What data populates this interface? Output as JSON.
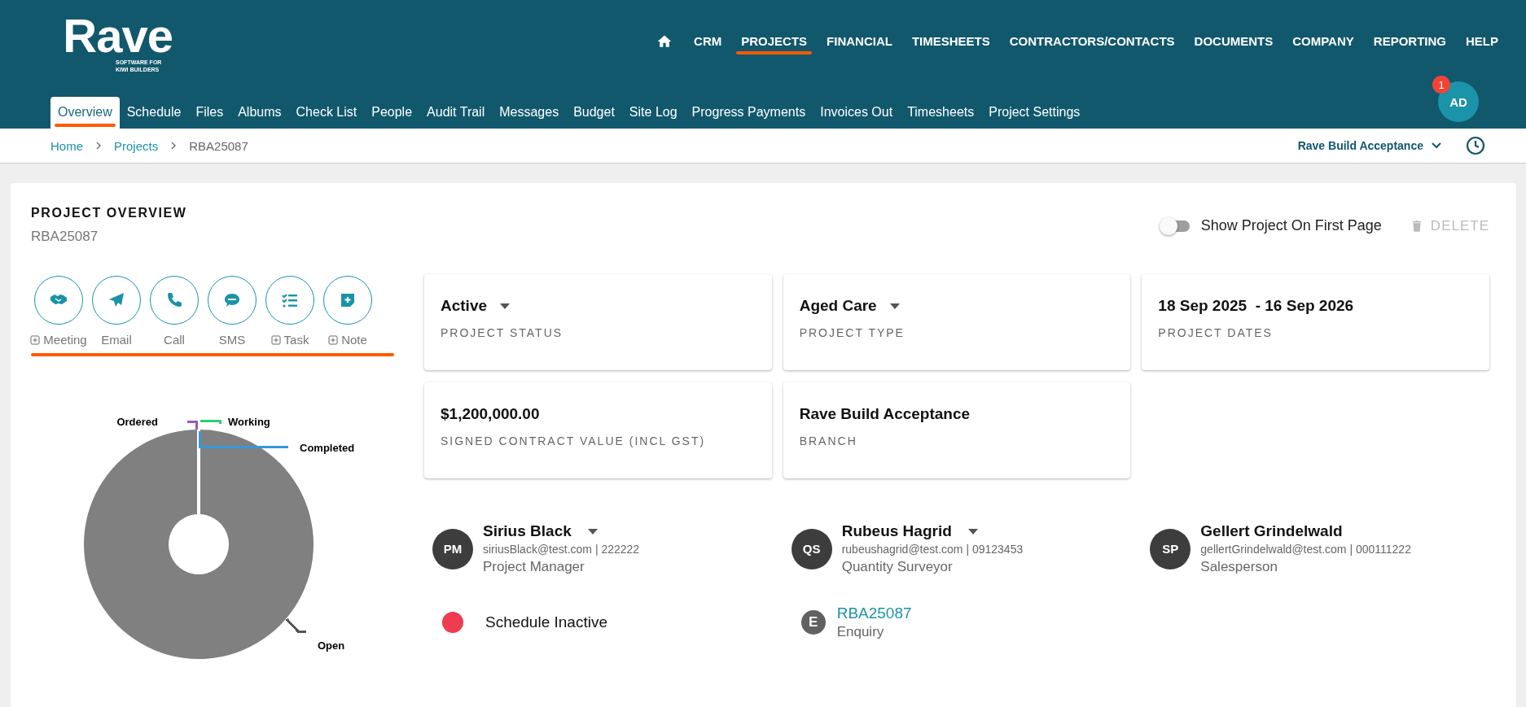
{
  "logo": {
    "name": "Rave",
    "tagline": "SOFTWARE FOR KIWI BUILDERS"
  },
  "top_nav": [
    {
      "label": "CRM",
      "selected": false
    },
    {
      "label": "PROJECTS",
      "selected": true
    },
    {
      "label": "FINANCIAL",
      "selected": false
    },
    {
      "label": "TIMESHEETS",
      "selected": false
    },
    {
      "label": "CONTRACTORS/CONTACTS",
      "selected": false
    },
    {
      "label": "DOCUMENTS",
      "selected": false
    },
    {
      "label": "COMPANY",
      "selected": false
    },
    {
      "label": "REPORTING",
      "selected": false
    },
    {
      "label": "HELP",
      "selected": false
    }
  ],
  "user": {
    "initials": "AD",
    "notifications": "1"
  },
  "tabs": [
    {
      "label": "Overview",
      "selected": true
    },
    {
      "label": "Schedule",
      "selected": false
    },
    {
      "label": "Files",
      "selected": false
    },
    {
      "label": "Albums",
      "selected": false
    },
    {
      "label": "Check List",
      "selected": false
    },
    {
      "label": "People",
      "selected": false
    },
    {
      "label": "Audit Trail",
      "selected": false
    },
    {
      "label": "Messages",
      "selected": false
    },
    {
      "label": "Budget",
      "selected": false
    },
    {
      "label": "Site Log",
      "selected": false
    },
    {
      "label": "Progress Payments",
      "selected": false
    },
    {
      "label": "Invoices Out",
      "selected": false
    },
    {
      "label": "Timesheets",
      "selected": false
    },
    {
      "label": "Project Settings",
      "selected": false
    }
  ],
  "breadcrumb": [
    "Home",
    "Projects",
    "RBA25087"
  ],
  "branch_selector": "Rave Build Acceptance",
  "overview": {
    "title": "PROJECT OVERVIEW",
    "code": "RBA25087",
    "show_on_first_page": {
      "label": "Show Project On First Page",
      "on": false
    },
    "delete": {
      "label": "DELETE",
      "disabled": true
    },
    "actions_highlighted": true,
    "actions": [
      {
        "kind": "meeting",
        "label": "Meeting",
        "add": true
      },
      {
        "kind": "email",
        "label": "Email",
        "add": false
      },
      {
        "kind": "call",
        "label": "Call",
        "add": false
      },
      {
        "kind": "sms",
        "label": "SMS",
        "add": false
      },
      {
        "kind": "task",
        "label": "Task",
        "add": true
      },
      {
        "kind": "note",
        "label": "Note",
        "add": true
      }
    ],
    "status_chart": {
      "labels": [
        {
          "text": "Ordered",
          "color": "#9b59b6"
        },
        {
          "text": "Working",
          "color": "#2ecc71"
        },
        {
          "text": "Completed",
          "color": "#3498db"
        },
        {
          "text": "Open",
          "color": "#555555"
        }
      ]
    },
    "cards": [
      {
        "value": "Active",
        "label": "PROJECT STATUS",
        "dropdown": true
      },
      {
        "value": "Aged Care",
        "label": "PROJECT TYPE",
        "dropdown": true
      },
      {
        "value": "18 Sep 2025  - 16 Sep 2026",
        "label": "PROJECT DATES",
        "dropdown": false
      },
      {
        "value": "$1,200,000.00",
        "label": "SIGNED CONTRACT VALUE (INCL GST)",
        "dropdown": false
      },
      {
        "value": "Rave Build Acceptance",
        "label": "BRANCH",
        "dropdown": false
      }
    ],
    "people": [
      {
        "initials": "PM",
        "name": "Sirius Black",
        "contact": "siriusBlack@test.com | 222222",
        "role": "Project Manager",
        "dropdown": true
      },
      {
        "initials": "QS",
        "name": "Rubeus Hagrid",
        "contact": "rubeushagrid@test.com | 09123453",
        "role": "Quantity Surveyor",
        "dropdown": true
      },
      {
        "initials": "SP",
        "name": "Gellert Grindelwald",
        "contact": "gellertGrindelwald@test.com | 000111222",
        "role": "Salesperson",
        "dropdown": false
      }
    ],
    "schedule_status": {
      "label": "Schedule Inactive",
      "color": "#f03c50"
    },
    "enquiry": {
      "badge": "E",
      "link": "RBA25087",
      "label": "Enquiry"
    }
  }
}
